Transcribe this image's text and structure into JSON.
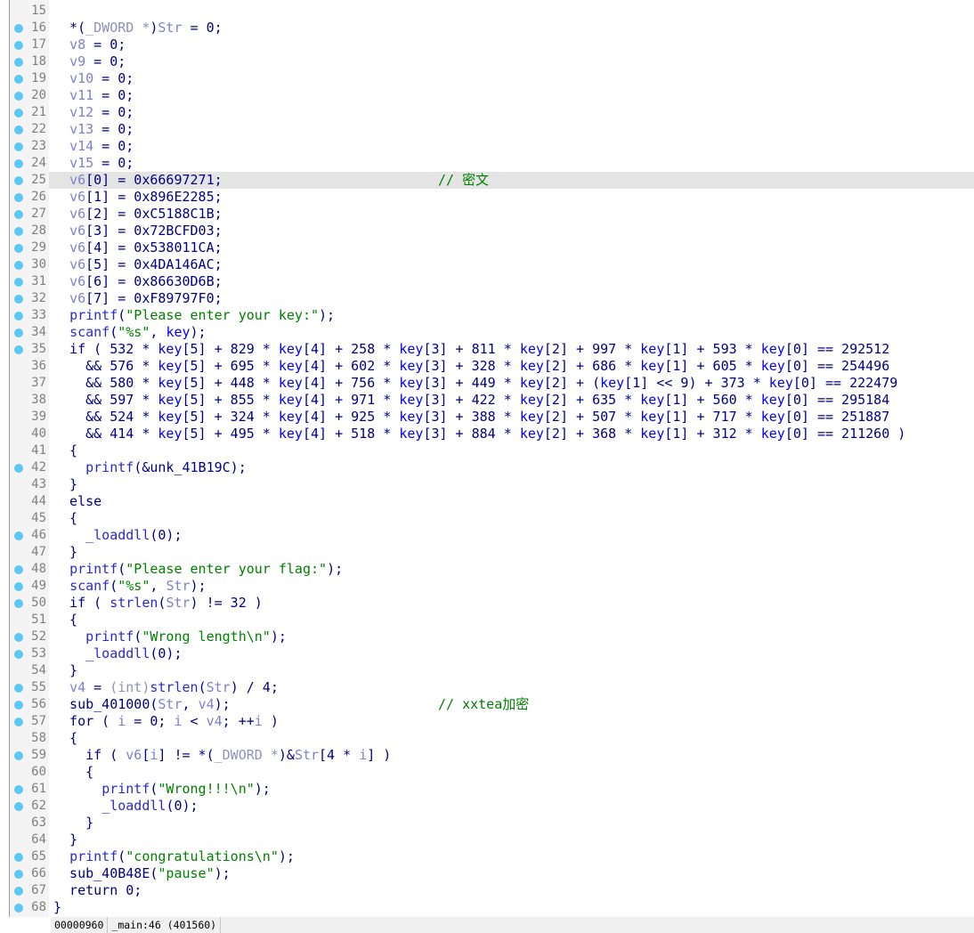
{
  "editor": {
    "highlight_line": 25,
    "lines": [
      {
        "n": "15",
        "dot": false,
        "code": []
      },
      {
        "n": "16",
        "dot": true,
        "code": [
          [
            "n",
            "  *("
          ],
          [
            "t",
            "_DWORD *"
          ],
          [
            "n",
            ")"
          ],
          [
            "v",
            "Str"
          ],
          [
            "n",
            " = 0;"
          ]
        ]
      },
      {
        "n": "17",
        "dot": true,
        "code": [
          [
            "n",
            "  "
          ],
          [
            "v",
            "v8"
          ],
          [
            "n",
            " = 0;"
          ]
        ]
      },
      {
        "n": "18",
        "dot": true,
        "code": [
          [
            "n",
            "  "
          ],
          [
            "v",
            "v9"
          ],
          [
            "n",
            " = 0;"
          ]
        ]
      },
      {
        "n": "19",
        "dot": true,
        "code": [
          [
            "n",
            "  "
          ],
          [
            "v",
            "v10"
          ],
          [
            "n",
            " = 0;"
          ]
        ]
      },
      {
        "n": "20",
        "dot": true,
        "code": [
          [
            "n",
            "  "
          ],
          [
            "v",
            "v11"
          ],
          [
            "n",
            " = 0;"
          ]
        ]
      },
      {
        "n": "21",
        "dot": true,
        "code": [
          [
            "n",
            "  "
          ],
          [
            "v",
            "v12"
          ],
          [
            "n",
            " = 0;"
          ]
        ]
      },
      {
        "n": "22",
        "dot": true,
        "code": [
          [
            "n",
            "  "
          ],
          [
            "v",
            "v13"
          ],
          [
            "n",
            " = 0;"
          ]
        ]
      },
      {
        "n": "23",
        "dot": true,
        "code": [
          [
            "n",
            "  "
          ],
          [
            "v",
            "v14"
          ],
          [
            "n",
            " = 0;"
          ]
        ]
      },
      {
        "n": "24",
        "dot": true,
        "code": [
          [
            "n",
            "  "
          ],
          [
            "v",
            "v15"
          ],
          [
            "n",
            " = 0;"
          ]
        ]
      },
      {
        "n": "25",
        "dot": true,
        "code": [
          [
            "n",
            "  "
          ],
          [
            "v",
            "v6"
          ],
          [
            "n",
            "[0] = 0x66697271;"
          ]
        ],
        "comment": "// 密文"
      },
      {
        "n": "26",
        "dot": true,
        "code": [
          [
            "n",
            "  "
          ],
          [
            "v",
            "v6"
          ],
          [
            "n",
            "[1] = 0x896E2285;"
          ]
        ]
      },
      {
        "n": "27",
        "dot": true,
        "code": [
          [
            "n",
            "  "
          ],
          [
            "v",
            "v6"
          ],
          [
            "n",
            "[2] = 0xC5188C1B;"
          ]
        ]
      },
      {
        "n": "28",
        "dot": true,
        "code": [
          [
            "n",
            "  "
          ],
          [
            "v",
            "v6"
          ],
          [
            "n",
            "[3] = 0x72BCFD03;"
          ]
        ]
      },
      {
        "n": "29",
        "dot": true,
        "code": [
          [
            "n",
            "  "
          ],
          [
            "v",
            "v6"
          ],
          [
            "n",
            "[4] = 0x538011CA;"
          ]
        ]
      },
      {
        "n": "30",
        "dot": true,
        "code": [
          [
            "n",
            "  "
          ],
          [
            "v",
            "v6"
          ],
          [
            "n",
            "[5] = 0x4DA146AC;"
          ]
        ]
      },
      {
        "n": "31",
        "dot": true,
        "code": [
          [
            "n",
            "  "
          ],
          [
            "v",
            "v6"
          ],
          [
            "n",
            "[6] = 0x86630D6B;"
          ]
        ]
      },
      {
        "n": "32",
        "dot": true,
        "code": [
          [
            "n",
            "  "
          ],
          [
            "v",
            "v6"
          ],
          [
            "n",
            "[7] = 0xF89797F0;"
          ]
        ]
      },
      {
        "n": "33",
        "dot": true,
        "code": [
          [
            "n",
            "  "
          ],
          [
            "f",
            "printf"
          ],
          [
            "n",
            "("
          ],
          [
            "s",
            "\"Please enter your key:\""
          ],
          [
            "n",
            ");"
          ]
        ]
      },
      {
        "n": "34",
        "dot": true,
        "code": [
          [
            "n",
            "  "
          ],
          [
            "f",
            "scanf"
          ],
          [
            "n",
            "("
          ],
          [
            "s",
            "\"%s\""
          ],
          [
            "n",
            ", "
          ],
          [
            "g",
            "key"
          ],
          [
            "n",
            ");"
          ]
        ]
      },
      {
        "n": "35",
        "dot": true,
        "code": [
          [
            "n",
            "  if ( 532 * "
          ],
          [
            "g",
            "key"
          ],
          [
            "n",
            "[5] + 829 * "
          ],
          [
            "g",
            "key"
          ],
          [
            "n",
            "[4] + 258 * "
          ],
          [
            "g",
            "key"
          ],
          [
            "n",
            "[3] + 811 * "
          ],
          [
            "g",
            "key"
          ],
          [
            "n",
            "[2] + 997 * "
          ],
          [
            "g",
            "key"
          ],
          [
            "n",
            "[1] + 593 * "
          ],
          [
            "g",
            "key"
          ],
          [
            "n",
            "[0] == 292512"
          ]
        ]
      },
      {
        "n": "36",
        "dot": false,
        "code": [
          [
            "n",
            "    && 576 * "
          ],
          [
            "g",
            "key"
          ],
          [
            "n",
            "[5] + 695 * "
          ],
          [
            "g",
            "key"
          ],
          [
            "n",
            "[4] + 602 * "
          ],
          [
            "g",
            "key"
          ],
          [
            "n",
            "[3] + 328 * "
          ],
          [
            "g",
            "key"
          ],
          [
            "n",
            "[2] + 686 * "
          ],
          [
            "g",
            "key"
          ],
          [
            "n",
            "[1] + 605 * "
          ],
          [
            "g",
            "key"
          ],
          [
            "n",
            "[0] == 254496"
          ]
        ]
      },
      {
        "n": "37",
        "dot": false,
        "code": [
          [
            "n",
            "    && 580 * "
          ],
          [
            "g",
            "key"
          ],
          [
            "n",
            "[5] + 448 * "
          ],
          [
            "g",
            "key"
          ],
          [
            "n",
            "[4] + 756 * "
          ],
          [
            "g",
            "key"
          ],
          [
            "n",
            "[3] + 449 * "
          ],
          [
            "g",
            "key"
          ],
          [
            "n",
            "[2] + ("
          ],
          [
            "g",
            "key"
          ],
          [
            "n",
            "[1] << 9) + 373 * "
          ],
          [
            "g",
            "key"
          ],
          [
            "n",
            "[0] == 222479"
          ]
        ]
      },
      {
        "n": "38",
        "dot": false,
        "code": [
          [
            "n",
            "    && 597 * "
          ],
          [
            "g",
            "key"
          ],
          [
            "n",
            "[5] + 855 * "
          ],
          [
            "g",
            "key"
          ],
          [
            "n",
            "[4] + 971 * "
          ],
          [
            "g",
            "key"
          ],
          [
            "n",
            "[3] + 422 * "
          ],
          [
            "g",
            "key"
          ],
          [
            "n",
            "[2] + 635 * "
          ],
          [
            "g",
            "key"
          ],
          [
            "n",
            "[1] + 560 * "
          ],
          [
            "g",
            "key"
          ],
          [
            "n",
            "[0] == 295184"
          ]
        ]
      },
      {
        "n": "39",
        "dot": false,
        "code": [
          [
            "n",
            "    && 524 * "
          ],
          [
            "g",
            "key"
          ],
          [
            "n",
            "[5] + 324 * "
          ],
          [
            "g",
            "key"
          ],
          [
            "n",
            "[4] + 925 * "
          ],
          [
            "g",
            "key"
          ],
          [
            "n",
            "[3] + 388 * "
          ],
          [
            "g",
            "key"
          ],
          [
            "n",
            "[2] + 507 * "
          ],
          [
            "g",
            "key"
          ],
          [
            "n",
            "[1] + 717 * "
          ],
          [
            "g",
            "key"
          ],
          [
            "n",
            "[0] == 251887"
          ]
        ]
      },
      {
        "n": "40",
        "dot": false,
        "code": [
          [
            "n",
            "    && 414 * "
          ],
          [
            "g",
            "key"
          ],
          [
            "n",
            "[5] + 495 * "
          ],
          [
            "g",
            "key"
          ],
          [
            "n",
            "[4] + 518 * "
          ],
          [
            "g",
            "key"
          ],
          [
            "n",
            "[3] + 884 * "
          ],
          [
            "g",
            "key"
          ],
          [
            "n",
            "[2] + 368 * "
          ],
          [
            "g",
            "key"
          ],
          [
            "n",
            "[1] + 312 * "
          ],
          [
            "g",
            "key"
          ],
          [
            "n",
            "[0] == 211260 )"
          ]
        ]
      },
      {
        "n": "41",
        "dot": false,
        "code": [
          [
            "n",
            "  {"
          ]
        ]
      },
      {
        "n": "42",
        "dot": true,
        "code": [
          [
            "n",
            "    "
          ],
          [
            "f",
            "printf"
          ],
          [
            "n",
            "(&unk_41B19C);"
          ]
        ]
      },
      {
        "n": "43",
        "dot": false,
        "code": [
          [
            "n",
            "  }"
          ]
        ]
      },
      {
        "n": "44",
        "dot": false,
        "code": [
          [
            "n",
            "  else"
          ]
        ]
      },
      {
        "n": "45",
        "dot": false,
        "code": [
          [
            "n",
            "  {"
          ]
        ]
      },
      {
        "n": "46",
        "dot": true,
        "code": [
          [
            "n",
            "    "
          ],
          [
            "f",
            "_loaddll"
          ],
          [
            "n",
            "(0);"
          ]
        ]
      },
      {
        "n": "47",
        "dot": false,
        "code": [
          [
            "n",
            "  }"
          ]
        ]
      },
      {
        "n": "48",
        "dot": true,
        "code": [
          [
            "n",
            "  "
          ],
          [
            "f",
            "printf"
          ],
          [
            "n",
            "("
          ],
          [
            "s",
            "\"Please enter your flag:\""
          ],
          [
            "n",
            ");"
          ]
        ]
      },
      {
        "n": "49",
        "dot": true,
        "code": [
          [
            "n",
            "  "
          ],
          [
            "f",
            "scanf"
          ],
          [
            "n",
            "("
          ],
          [
            "s",
            "\"%s\""
          ],
          [
            "n",
            ", "
          ],
          [
            "v",
            "Str"
          ],
          [
            "n",
            ");"
          ]
        ]
      },
      {
        "n": "50",
        "dot": true,
        "code": [
          [
            "n",
            "  if ( "
          ],
          [
            "f",
            "strlen"
          ],
          [
            "n",
            "("
          ],
          [
            "v",
            "Str"
          ],
          [
            "n",
            ") != 32 )"
          ]
        ]
      },
      {
        "n": "51",
        "dot": false,
        "code": [
          [
            "n",
            "  {"
          ]
        ]
      },
      {
        "n": "52",
        "dot": true,
        "code": [
          [
            "n",
            "    "
          ],
          [
            "f",
            "printf"
          ],
          [
            "n",
            "("
          ],
          [
            "s",
            "\"Wrong length\\n\""
          ],
          [
            "n",
            ");"
          ]
        ]
      },
      {
        "n": "53",
        "dot": true,
        "code": [
          [
            "n",
            "    "
          ],
          [
            "f",
            "_loaddll"
          ],
          [
            "n",
            "(0);"
          ]
        ]
      },
      {
        "n": "54",
        "dot": false,
        "code": [
          [
            "n",
            "  }"
          ]
        ]
      },
      {
        "n": "55",
        "dot": true,
        "code": [
          [
            "n",
            "  "
          ],
          [
            "v",
            "v4"
          ],
          [
            "n",
            " = "
          ],
          [
            "t",
            "(int)"
          ],
          [
            "f",
            "strlen"
          ],
          [
            "n",
            "("
          ],
          [
            "v",
            "Str"
          ],
          [
            "n",
            ") / 4;"
          ]
        ]
      },
      {
        "n": "56",
        "dot": true,
        "code": [
          [
            "n",
            "  sub_401000("
          ],
          [
            "v",
            "Str"
          ],
          [
            "n",
            ", "
          ],
          [
            "v",
            "v4"
          ],
          [
            "n",
            ");"
          ]
        ],
        "comment": "// xxtea加密"
      },
      {
        "n": "57",
        "dot": true,
        "code": [
          [
            "n",
            "  for ( "
          ],
          [
            "v",
            "i"
          ],
          [
            "n",
            " = 0; "
          ],
          [
            "v",
            "i"
          ],
          [
            "n",
            " < "
          ],
          [
            "v",
            "v4"
          ],
          [
            "n",
            "; ++"
          ],
          [
            "v",
            "i"
          ],
          [
            "n",
            " )"
          ]
        ]
      },
      {
        "n": "58",
        "dot": false,
        "code": [
          [
            "n",
            "  {"
          ]
        ]
      },
      {
        "n": "59",
        "dot": true,
        "code": [
          [
            "n",
            "    if ( "
          ],
          [
            "v",
            "v6"
          ],
          [
            "n",
            "["
          ],
          [
            "v",
            "i"
          ],
          [
            "n",
            "] != *("
          ],
          [
            "t",
            "_DWORD *"
          ],
          [
            "n",
            ")&"
          ],
          [
            "v",
            "Str"
          ],
          [
            "n",
            "[4 * "
          ],
          [
            "v",
            "i"
          ],
          [
            "n",
            "] )"
          ]
        ]
      },
      {
        "n": "60",
        "dot": false,
        "code": [
          [
            "n",
            "    {"
          ]
        ]
      },
      {
        "n": "61",
        "dot": true,
        "code": [
          [
            "n",
            "      "
          ],
          [
            "f",
            "printf"
          ],
          [
            "n",
            "("
          ],
          [
            "s",
            "\"Wrong!!!\\n\""
          ],
          [
            "n",
            ");"
          ]
        ]
      },
      {
        "n": "62",
        "dot": true,
        "code": [
          [
            "n",
            "      "
          ],
          [
            "f",
            "_loaddll"
          ],
          [
            "n",
            "(0);"
          ]
        ]
      },
      {
        "n": "63",
        "dot": false,
        "code": [
          [
            "n",
            "    }"
          ]
        ]
      },
      {
        "n": "64",
        "dot": false,
        "code": [
          [
            "n",
            "  }"
          ]
        ]
      },
      {
        "n": "65",
        "dot": true,
        "code": [
          [
            "n",
            "  "
          ],
          [
            "f",
            "printf"
          ],
          [
            "n",
            "("
          ],
          [
            "s",
            "\"congratulations\\n\""
          ],
          [
            "n",
            ");"
          ]
        ]
      },
      {
        "n": "66",
        "dot": true,
        "code": [
          [
            "n",
            "  sub_40B48E("
          ],
          [
            "s",
            "\"pause\""
          ],
          [
            "n",
            ");"
          ]
        ]
      },
      {
        "n": "67",
        "dot": true,
        "code": [
          [
            "n",
            "  return 0;"
          ]
        ]
      },
      {
        "n": "68",
        "dot": true,
        "code": [
          [
            "n",
            "}"
          ]
        ]
      }
    ]
  },
  "status": {
    "offset": "00000960",
    "location": "_main:46 (401560)"
  },
  "colors": {
    "keyword": "#000080",
    "local_var": "#7f7fd0",
    "global": "#0000ff",
    "string": "#008000",
    "comment": "#008000",
    "breakpoint_dot": "#5cc8f5",
    "highlight": "#e4e4e4"
  }
}
